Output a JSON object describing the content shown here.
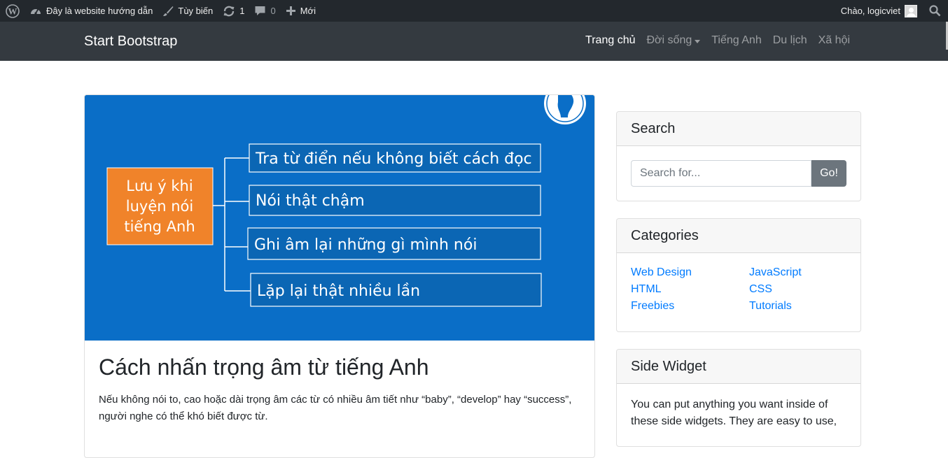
{
  "adminbar": {
    "site_name": "Đây là website hướng dẫn",
    "customize": "Tùy biến",
    "updates_count": "1",
    "comments_count": "0",
    "new": "Mới",
    "greeting": "Chào, logicviet"
  },
  "navbar": {
    "brand": "Start Bootstrap",
    "links": [
      {
        "label": "Trang chủ"
      },
      {
        "label": "Đời sống"
      },
      {
        "label": "Tiếng Anh"
      },
      {
        "label": "Du lịch"
      },
      {
        "label": "Xã hội"
      }
    ]
  },
  "post": {
    "image": {
      "main_label_lines": [
        "Lưu ý khi",
        "luyện nói",
        "tiếng Anh"
      ],
      "tips": [
        "Tra từ điển nếu không biết cách đọc",
        "Nói thật chậm",
        "Ghi âm lại những gì mình nói",
        "Lặp lại thật nhiều lần"
      ]
    },
    "title": "Cách nhấn trọng âm từ tiếng Anh",
    "excerpt": "Nếu không nói to, cao hoặc dài trọng âm các từ có nhiều âm tiết như “baby”, “develop” hay “success”, người nghe có thể khó biết được từ."
  },
  "sidebar": {
    "search": {
      "title": "Search",
      "placeholder": "Search for...",
      "button": "Go!"
    },
    "categories": {
      "title": "Categories",
      "items": [
        "Web Design",
        "JavaScript",
        "HTML",
        "CSS",
        "Freebies",
        "Tutorials"
      ]
    },
    "widget": {
      "title": "Side Widget",
      "text": "You can put anything you want inside of these side widgets. They are easy to use,"
    }
  },
  "colors": {
    "adminbar_bg": "#23282d",
    "navbar_bg": "#343a40",
    "link": "#007bff",
    "image_bg": "#0a6ec7",
    "image_box": "#f0832a"
  }
}
